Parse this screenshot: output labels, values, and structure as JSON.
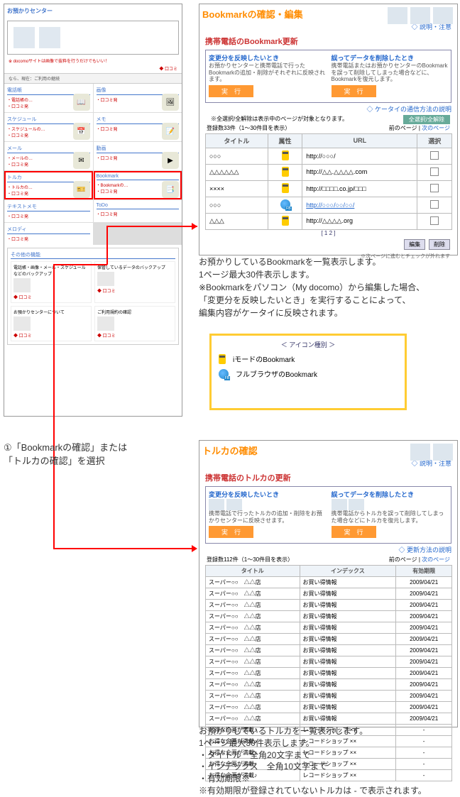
{
  "left_panel": {
    "title": "お預かりセンター",
    "banner_text": "※ docomoサイトは画像で抜粋を行うだけでもいい！",
    "link_text": "◆ 口コミ",
    "bar_text": "なら、現在：ご利用の継続",
    "cells": [
      {
        "title": "電話帳",
        "links": [
          "・電話帳の…",
          "・口コミ発"
        ],
        "icon": "📖"
      },
      {
        "title": "画像",
        "links": [
          "・口コミ発"
        ],
        "icon": "🖼"
      },
      {
        "title": "スケジュール",
        "links": [
          "・スケジュールの…",
          "・口コミ発"
        ],
        "icon": "📅"
      },
      {
        "title": "メモ",
        "links": [
          "・口コミ発"
        ],
        "icon": "📝"
      },
      {
        "title": "メール",
        "links": [
          "・メールの…",
          "・口コミ発"
        ],
        "icon": "✉"
      },
      {
        "title": "動画",
        "links": [
          "・口コミ発"
        ],
        "icon": "▶"
      },
      {
        "title": "トルカ",
        "links": [
          "・トルカの…",
          "・口コミ発"
        ],
        "icon": "🎫",
        "hl": true
      },
      {
        "title": "Bookmark",
        "links": [
          "・Bookmarkの…",
          "・口コミ発"
        ],
        "icon": "📑",
        "hl": true
      },
      {
        "title": "テキストメモ",
        "links": [
          "・口コミ発"
        ]
      },
      {
        "title": "ToDo",
        "links": [
          "・口コミ発"
        ]
      },
      {
        "title": "メロディ",
        "links": [
          "・口コミ発"
        ]
      }
    ],
    "section2_title": "その他の機能",
    "subs": [
      {
        "title": "電話帳・画像・メール・スケジュールなどのバックアップ",
        "link": "◆ 口コミ"
      },
      {
        "title": "保管しているデータのバックアップ",
        "link": "◆ 口コミ"
      },
      {
        "title": "お預かりセンターについて",
        "link": "◆ 口コミ"
      },
      {
        "title": "ご利用規約の確認",
        "link": "◆ 口コミ"
      }
    ]
  },
  "caption1": {
    "line1": "①「Bookmarkの確認」または",
    "line2": "「トルカの確認」を選択"
  },
  "bookmark": {
    "title": "Bookmarkの確認・編集",
    "help": "◇ 説明・注意",
    "h2": "携帯電話のBookmark更新",
    "col1_title": "変更分を反映したいとき",
    "col1_text": "お預かりセンターと携帯電話で行ったBookmarkの追加・削除がそれぞれに反映されます。",
    "col2_title": "誤ってデータを削除したとき",
    "col2_text": "携帯電話またはお預かりセンターのBookmarkを誤って削除してしまった場合などに、Bookmarkを復元します。",
    "btn": "実　行",
    "link_below": "◇ ケータイの通信方法の説明",
    "note": "※全選択/全解除は表示中のページが対象となります。",
    "selbtn": "全選択/全解除",
    "count": "登録数33件（1〜30件目を表示）",
    "paging_prev": "前のページ",
    "paging_next": "次のページ",
    "th1": "タイトル",
    "th2": "属性",
    "th3": "URL",
    "th4": "選択",
    "rows": [
      {
        "title": "○○○",
        "type": "im",
        "url": "http://○○○/"
      },
      {
        "title": "△△△△△△",
        "type": "im",
        "url": "http://△△.△△△△.com"
      },
      {
        "title": "××××",
        "type": "im",
        "url": "http://□□□□.co.jp/□□□"
      },
      {
        "title": "○○○",
        "type": "fb",
        "url": "http://○○○/○○/○○/"
      },
      {
        "title": "△△△",
        "type": "im",
        "url": "http://△△△△.org"
      }
    ],
    "pager_bottom": "[ 1 2 ]",
    "edit_btn": "編集",
    "del_btn": "削除",
    "small_note": "※次ページに進むとチェックが外れます"
  },
  "caption2": {
    "l1": "お預かりしているBookmarkを一覧表示します。",
    "l2": "1ページ最大30件表示します。",
    "l3": "※Bookmarkをパソコン（My docomo）から編集した場合、",
    "l4": "「変更分を反映したいとき」を実行することによって、",
    "l5": "編集内容がケータイに反映されます。"
  },
  "legend": {
    "title": "＜ アイコン種別 ＞",
    "r1": "iモードのBookmark",
    "r2": "フルブラウザのBookmark"
  },
  "toruca": {
    "title": "トルカの確認",
    "help": "◇ 説明・注意",
    "h2": "携帯電話のトルカの更新",
    "col1_title": "変更分を反映したいとき",
    "col1_text": "携帯電話で行ったトルカの追加・削除をお預かりセンターに反映させます。",
    "col2_title": "誤ってデータを削除したとき",
    "col2_text": "携帯電話からトルカを誤って削除してしまった場合などにトルカを復元します。",
    "btn": "実　行",
    "link_below": "◇ 更新方法の説明",
    "count": "登録数112件（1〜30件目を表示）",
    "paging_prev": "前のページ",
    "paging_next": "次のページ",
    "th1": "タイトル",
    "th2": "インデックス",
    "th3": "有効期限",
    "rows_main": [
      {
        "title": "スーパー○○　△△店",
        "idx": "お買い得情報",
        "exp": "2009/04/21"
      },
      {
        "title": "スーパー○○　△△店",
        "idx": "お買い得情報",
        "exp": "2009/04/21"
      },
      {
        "title": "スーパー○○　△△店",
        "idx": "お買い得情報",
        "exp": "2009/04/21"
      },
      {
        "title": "スーパー○○　△△店",
        "idx": "お買い得情報",
        "exp": "2009/04/21"
      },
      {
        "title": "スーパー○○　△△店",
        "idx": "お買い得情報",
        "exp": "2009/04/21"
      },
      {
        "title": "スーパー○○　△△店",
        "idx": "お買い得情報",
        "exp": "2009/04/21"
      },
      {
        "title": "スーパー○○　△△店",
        "idx": "お買い得情報",
        "exp": "2009/04/21"
      },
      {
        "title": "スーパー○○　△△店",
        "idx": "お買い得情報",
        "exp": "2009/04/21"
      },
      {
        "title": "スーパー○○　△△店",
        "idx": "お買い得情報",
        "exp": "2009/04/21"
      },
      {
        "title": "スーパー○○　△△店",
        "idx": "お買い得情報",
        "exp": "2009/04/21"
      },
      {
        "title": "スーパー○○　△△店",
        "idx": "お買い得情報",
        "exp": "2009/04/21"
      },
      {
        "title": "スーパー○○　△△店",
        "idx": "お買い得情報",
        "exp": "2009/04/21"
      },
      {
        "title": "スーパー○○　△△店",
        "idx": "お買い得情報",
        "exp": "2009/04/21"
      },
      {
        "title": "お得な企画が満載♪",
        "idx": "レコードショップ ××",
        "exp": "-"
      },
      {
        "title": "お得な企画が満載♪",
        "idx": "レコードショップ ××",
        "exp": "-"
      },
      {
        "title": "お得な企画が満載♪",
        "idx": "レコードショップ ××",
        "exp": "-"
      },
      {
        "title": "お得な企画が満載♪",
        "idx": "レコードショップ ××",
        "exp": "-"
      },
      {
        "title": "お得な企画が満載♪",
        "idx": "レコードショップ ××",
        "exp": "-"
      }
    ]
  },
  "caption3": {
    "l1": "お預かりしているトルカを一覧表示します。",
    "l2": "1ページ最大30件表示します。",
    "l3": "・タイトル　全角20文字まで",
    "l4": "・インデックス　全角10文字まで",
    "l5": "・有効期限※",
    "l6": "※有効期限が登録されていないトルカは - で表示されます。"
  }
}
